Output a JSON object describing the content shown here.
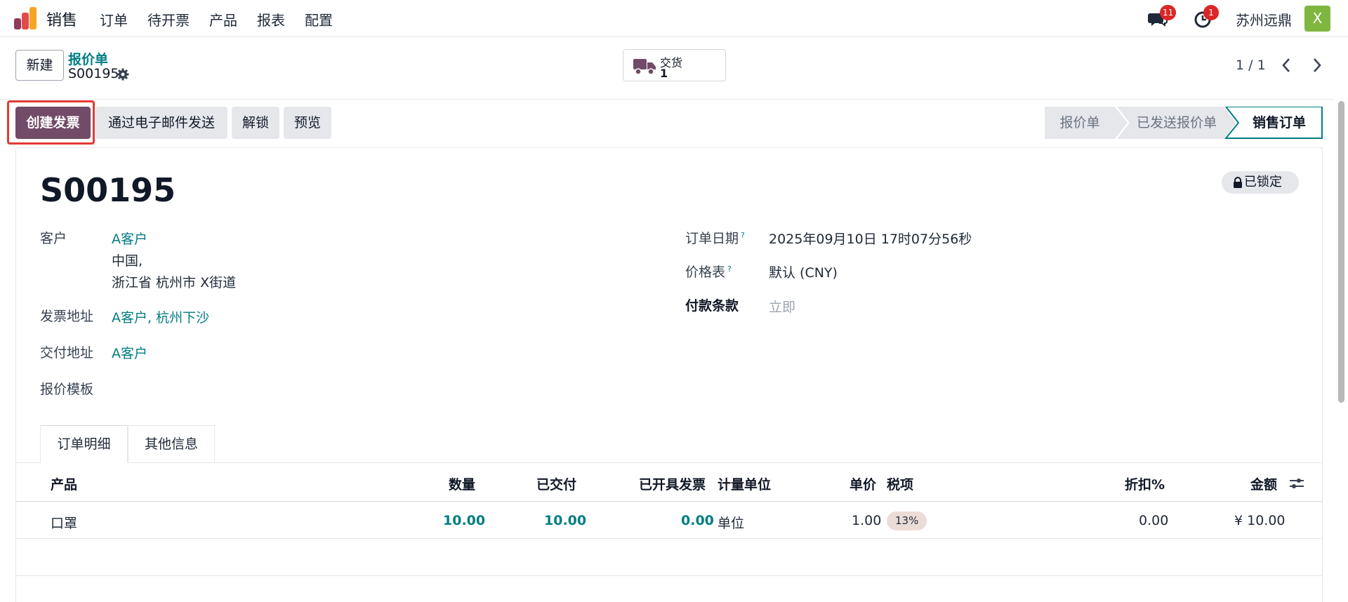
{
  "nav": {
    "app_name": "销售",
    "menu": [
      "订单",
      "待开票",
      "产品",
      "报表",
      "配置"
    ],
    "messages_count": "11",
    "activities_count": "1",
    "company": "苏州远鼎",
    "avatar_letter": "X"
  },
  "control": {
    "new_label": "新建",
    "breadcrumb_parent": "报价单",
    "breadcrumb_current": "S00195",
    "delivery_label": "交货",
    "delivery_count": "1",
    "pager": "1 / 1"
  },
  "actions": {
    "create_invoice": "创建发票",
    "send_email": "通过电子邮件发送",
    "unlock": "解锁",
    "preview": "预览"
  },
  "status_stages": [
    "报价单",
    "已发送报价单",
    "销售订单"
  ],
  "active_stage": "销售订单",
  "form": {
    "order_name": "S00195",
    "locked_label": "已锁定",
    "customer_label": "客户",
    "customer_name": "A客户",
    "customer_country": "中国,",
    "customer_address": "浙江省 杭州市 X街道",
    "invoice_address_label": "发票地址",
    "invoice_address": "A客户, 杭州下沙",
    "delivery_address_label": "交付地址",
    "delivery_address": "A客户",
    "quote_template_label": "报价模板",
    "order_date_label": "订单日期",
    "order_date": "2025年09月10日 17时07分56秒",
    "pricelist_label": "价格表",
    "pricelist": "默认 (CNY)",
    "payment_terms_label": "付款条款",
    "payment_terms": "立即",
    "help_mark": "?"
  },
  "tabs": [
    "订单明细",
    "其他信息"
  ],
  "table": {
    "headers": {
      "product": "产品",
      "qty": "数量",
      "delivered": "已交付",
      "invoiced": "已开具发票",
      "uom": "计量单位",
      "price": "单价",
      "tax": "税项",
      "discount": "折扣%",
      "amount": "金额"
    },
    "rows": [
      {
        "product": "口罩",
        "qty": "10.00",
        "delivered": "10.00",
        "invoiced": "0.00",
        "uom": "单位",
        "price": "1.00",
        "tax": "13%",
        "discount": "0.00",
        "amount": "¥ 10.00"
      }
    ]
  },
  "colors": {
    "primary": "#714b67",
    "link": "#017e84",
    "highlight": "#e53935"
  }
}
